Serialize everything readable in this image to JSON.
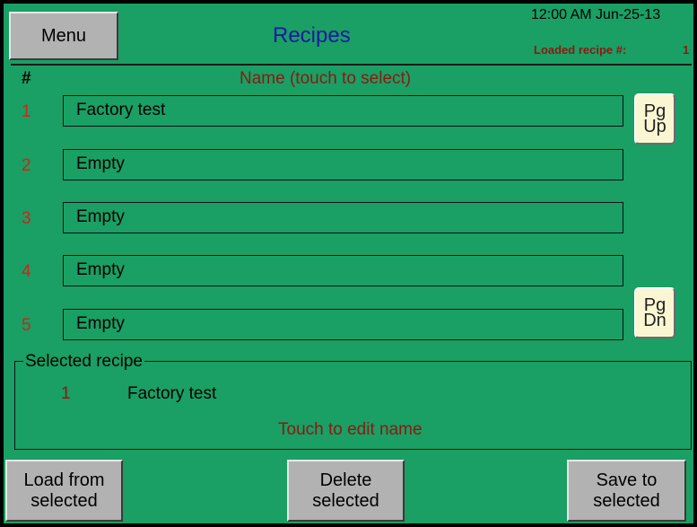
{
  "header": {
    "menu_label": "Menu",
    "title": "Recipes",
    "datetime": "12:00 AM Jun-25-13",
    "loaded_label": "Loaded recipe #:",
    "loaded_value": "1"
  },
  "list": {
    "col_number": "#",
    "col_name": "Name (touch to select)",
    "rows": [
      {
        "num": "1",
        "name": "Factory test"
      },
      {
        "num": "2",
        "name": "Empty"
      },
      {
        "num": "3",
        "name": "Empty"
      },
      {
        "num": "4",
        "name": "Empty"
      },
      {
        "num": "5",
        "name": "Empty"
      }
    ],
    "page_up_label": "Pg\nUp",
    "page_down_label": "Pg\nDn"
  },
  "selected": {
    "title": "Selected recipe",
    "num": "1",
    "name": "Factory test",
    "edit_hint": "Touch to edit name"
  },
  "footer": {
    "load_label": "Load from\nselected",
    "delete_label": "Delete\nselected",
    "save_label": "Save to\nselected"
  },
  "colors": {
    "background": "#1a9f64",
    "title": "#1a1aa0",
    "accent_red": "#8b1a12",
    "row_number": "#c8281a",
    "button": "#b2b2b2",
    "page_button": "#fbf6d2"
  }
}
